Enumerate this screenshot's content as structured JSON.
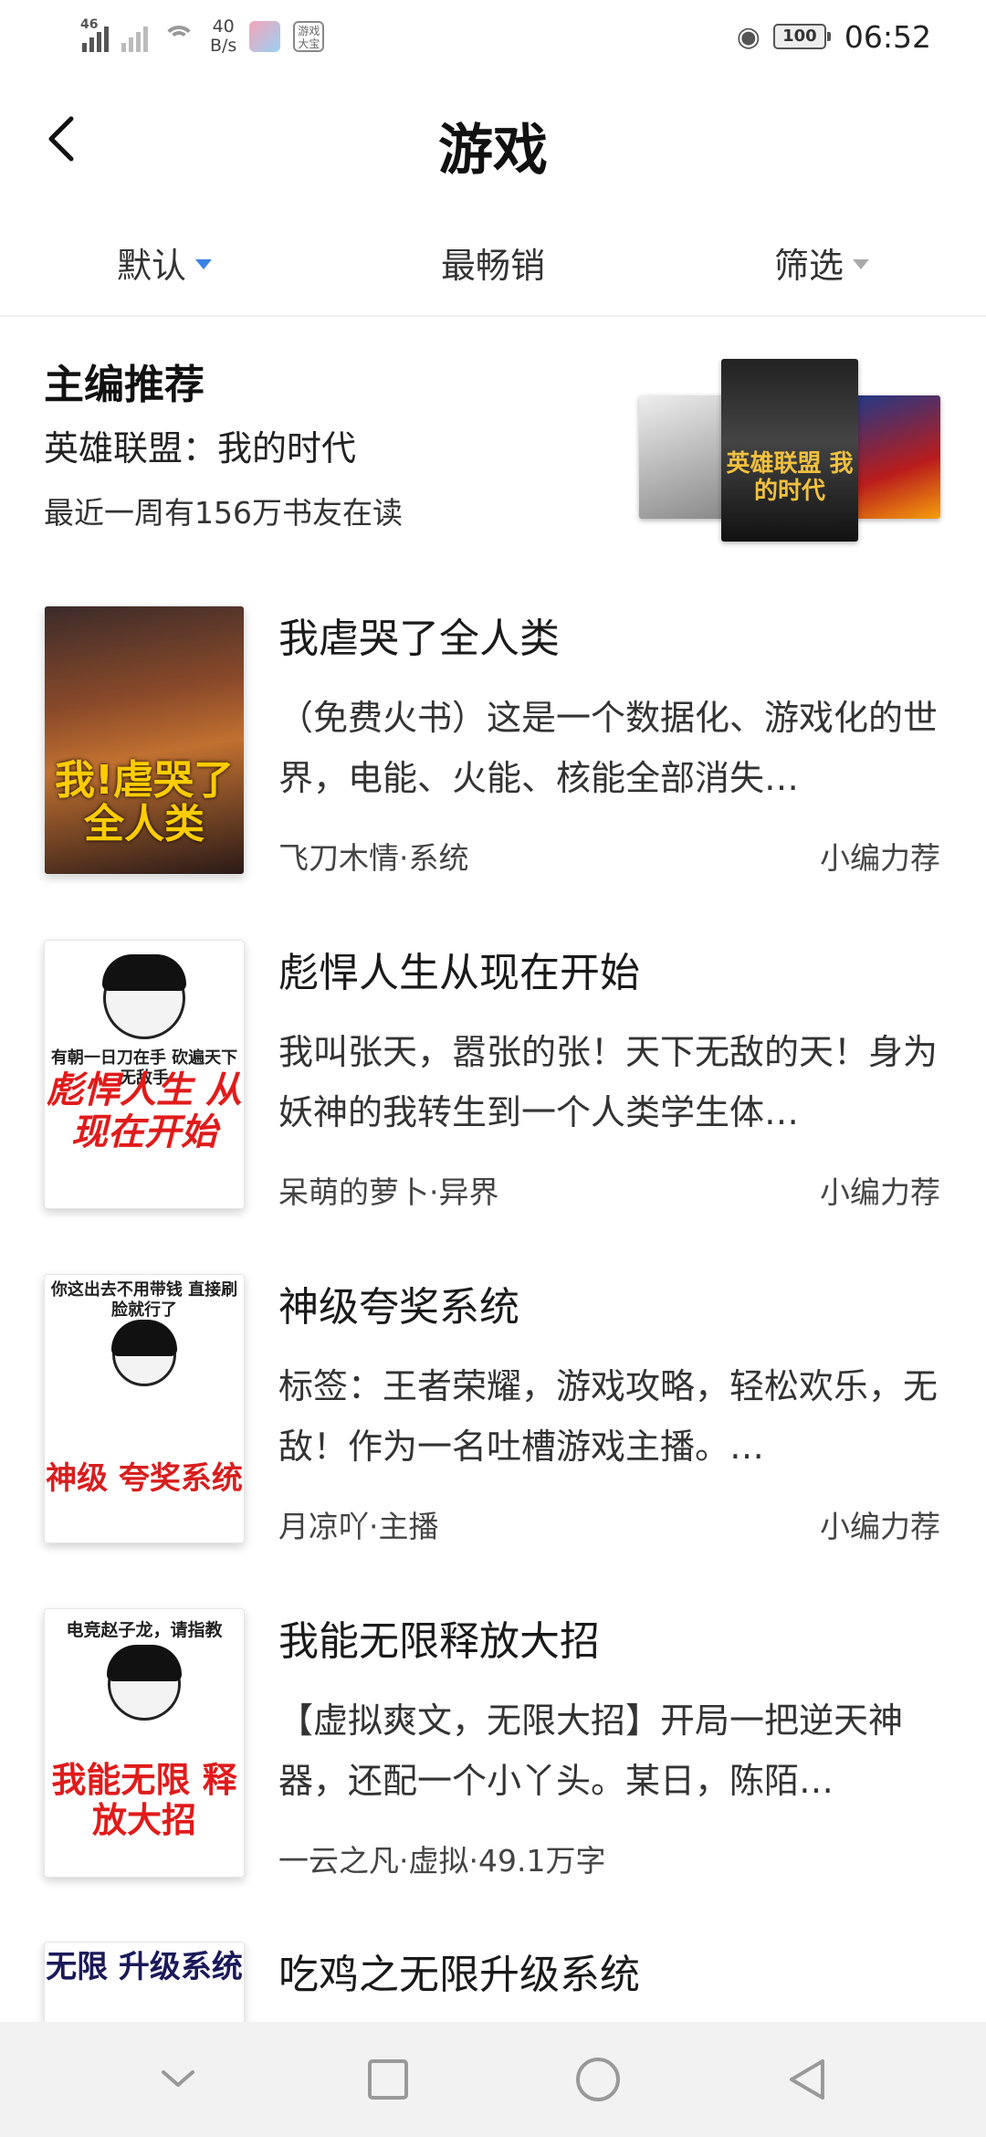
{
  "status_bar": {
    "network": "46",
    "speed_value": "40",
    "speed_unit": "B/s",
    "app_badge": "游戏大宝",
    "battery": "100",
    "time": "06:52"
  },
  "header": {
    "title": "游戏",
    "back_icon": "chevron-left-icon"
  },
  "tabs": [
    {
      "label": "默认",
      "has_dropdown": true,
      "active": true
    },
    {
      "label": "最畅销",
      "has_dropdown": false,
      "active": false
    },
    {
      "label": "筛选",
      "has_dropdown": true,
      "active": false
    }
  ],
  "editor_pick": {
    "heading": "主编推荐",
    "book_title": "英雄联盟：我的时代",
    "readers": "最近一周有156万书友在读",
    "center_cover_text": "英雄联盟 我的时代"
  },
  "books": [
    {
      "title": "我虐哭了全人类",
      "description": "（免费火书）这是一个数据化、游戏化的世界，电能、火能、核能全部消失…",
      "meta": "飞刀木情·系统",
      "tag": "小编力荐",
      "cover_text": "我!虐哭了全人类"
    },
    {
      "title": "彪悍人生从现在开始",
      "description": "我叫张天，嚣张的张！天下无敌的天！身为妖神的我转生到一个人类学生体…",
      "meta": "呆萌的萝卜·异界",
      "tag": "小编力荐",
      "cover_text": "彪悍人生 从现在开始",
      "cover_small": "有朝一日刀在手 砍遍天下无敌手"
    },
    {
      "title": "神级夸奖系统",
      "description": "标签：王者荣耀，游戏攻略，轻松欢乐，无敌！作为一名吐槽游戏主播。…",
      "meta": "月凉吖·主播",
      "tag": "小编力荐",
      "cover_text": "神级 夸奖系统",
      "cover_small": "你这出去不用带钱 直接刷脸就行了"
    },
    {
      "title": "我能无限释放大招",
      "description": "【虚拟爽文，无限大招】开局一把逆天神器，还配一个小丫头。某日，陈陌…",
      "meta": "一云之凡·虚拟·49.1万字",
      "tag": "",
      "cover_text": "我能无限 释放大招",
      "cover_small": "电竞赵子龙，请指教"
    },
    {
      "title": "吃鸡之无限升级系统",
      "description": "",
      "meta": "",
      "tag": "",
      "cover_text": "无限 升级系统"
    }
  ],
  "nav_bar": {
    "icons": [
      "chevron-down-icon",
      "square-icon",
      "circle-icon",
      "triangle-back-icon"
    ]
  },
  "colors": {
    "accent": "#3b82e6",
    "nav_bg": "#f2f2f2"
  }
}
